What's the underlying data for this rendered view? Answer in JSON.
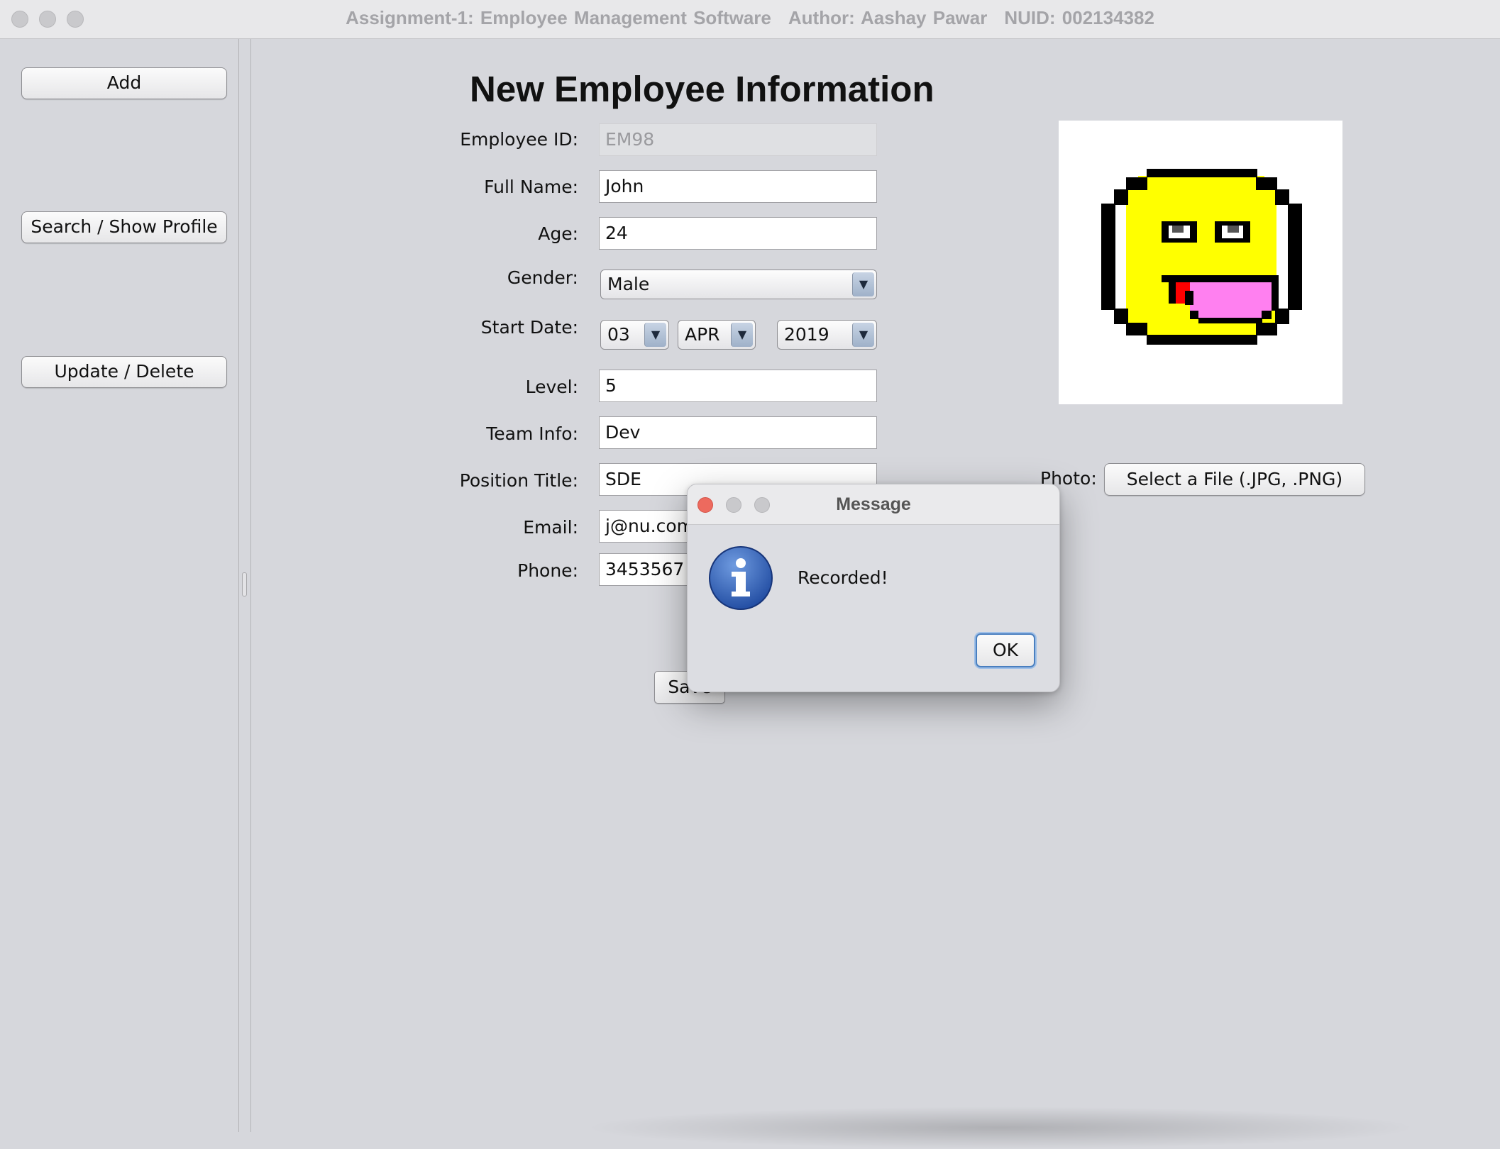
{
  "window": {
    "title": "Assignment-1: Employee Management Software",
    "author": "Author: Aashay Pawar",
    "nuid": "NUID: 002134382"
  },
  "sidebar": {
    "add_label": "Add",
    "search_label": "Search / Show Profile",
    "update_label": "Update / Delete"
  },
  "form": {
    "heading": "New Employee Information",
    "employee_id": {
      "label": "Employee ID:",
      "value": "EM98"
    },
    "full_name": {
      "label": "Full Name:",
      "value": "John"
    },
    "age": {
      "label": "Age:",
      "value": "24"
    },
    "gender": {
      "label": "Gender:",
      "selected": "Male"
    },
    "start_date": {
      "label": "Start Date:",
      "day": "03",
      "month": "APR",
      "year": "2019"
    },
    "level": {
      "label": "Level:",
      "value": "5"
    },
    "team_info": {
      "label": "Team Info:",
      "value": "Dev"
    },
    "position_title": {
      "label": "Position Title:",
      "value": "SDE"
    },
    "email": {
      "label": "Email:",
      "value": "j@nu.com"
    },
    "phone": {
      "label": "Phone:",
      "value": "3453567"
    },
    "photo": {
      "label": "Photo:",
      "button_label": "Select a File (.JPG, .PNG)"
    },
    "save_label": "Save"
  },
  "dialog": {
    "title": "Message",
    "message": "Recorded!",
    "ok_label": "OK"
  },
  "colors": {
    "window_bg": "#d6d7dc",
    "smiley_yellow": "#ffff00",
    "tongue_pink": "#ff80f0",
    "tongue_red": "#ff0000",
    "info_blue": "#2e5fb8"
  }
}
